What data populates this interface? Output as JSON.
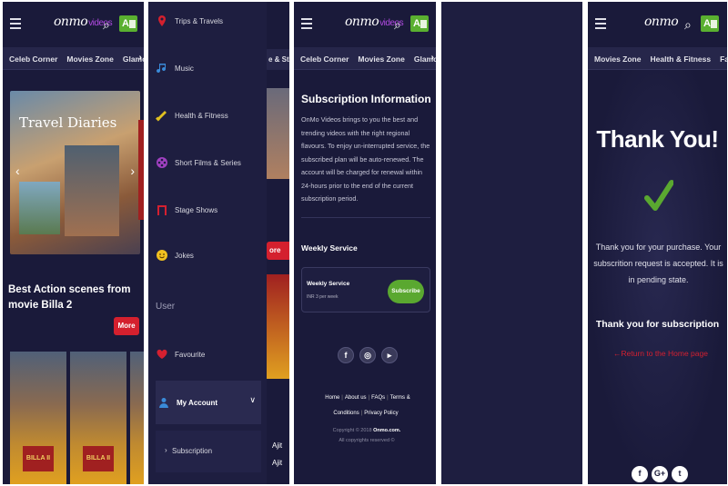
{
  "common": {
    "logo_text": "onmo",
    "logo_sub": "videos",
    "lang_label": "A"
  },
  "screen1": {
    "categories": [
      "Celeb Corner",
      "Movies Zone",
      "Glamour & St"
    ],
    "hero_title": "Travel Diaries",
    "movie_title": "Best Action scenes from movie Billa 2",
    "more_label": "More",
    "poster_badge": "BILLA II"
  },
  "screen2": {
    "menu_items": [
      {
        "label": "Trips & Travels",
        "icon": "pin-icon"
      },
      {
        "label": "Music",
        "icon": "music-note-icon"
      },
      {
        "label": "Health & Fitness",
        "icon": "dumbbell-icon"
      },
      {
        "label": "Short Films & Series",
        "icon": "film-reel-icon"
      },
      {
        "label": "Stage Shows",
        "icon": "stage-icon"
      },
      {
        "label": "Jokes",
        "icon": "smiley-icon"
      }
    ],
    "section_user": "User",
    "favourite_label": "Favourite",
    "my_account_label": "My Account",
    "subscription_label": "Subscription",
    "strip_cat": "e & St",
    "strip_more": "ore",
    "strip_name": "Ajit"
  },
  "screen3": {
    "categories": [
      "Celeb Corner",
      "Movies Zone",
      "Glamour & St"
    ],
    "title": "Subscription Information",
    "body": "OnMo Videos brings to you the best and trending videos with the right regional flavours. To enjoy un-interrupted service, the subscribed plan will be auto-renewed. The account will be charged for renewal within 24-hours prior to the end of the current subscription period.",
    "weekly_heading": "Weekly Service",
    "plan_name": "Weekly Service",
    "plan_price": "INR 3 per week",
    "subscribe_label": "Subscribe",
    "footer_links": [
      "Home",
      "About us",
      "FAQs",
      "Terms & Conditions",
      "Privacy Policy"
    ],
    "copyright_line1_pre": "Copyright © 2018",
    "copyright_brand": "Onmo.com.",
    "copyright_line2": "All copyrights reserved ©"
  },
  "screen5": {
    "categories": [
      "Movies Zone",
      "Health & Fitness",
      "Faith &"
    ],
    "thanks_title": "Thank You!",
    "thanks_msg": "Thank you for your purchase. Your subscrition request is accepted. It is in pending state.",
    "thanks_sub": "Thank you for subscription",
    "home_link": "Return to the Home page",
    "check_color": "#5aa830"
  }
}
